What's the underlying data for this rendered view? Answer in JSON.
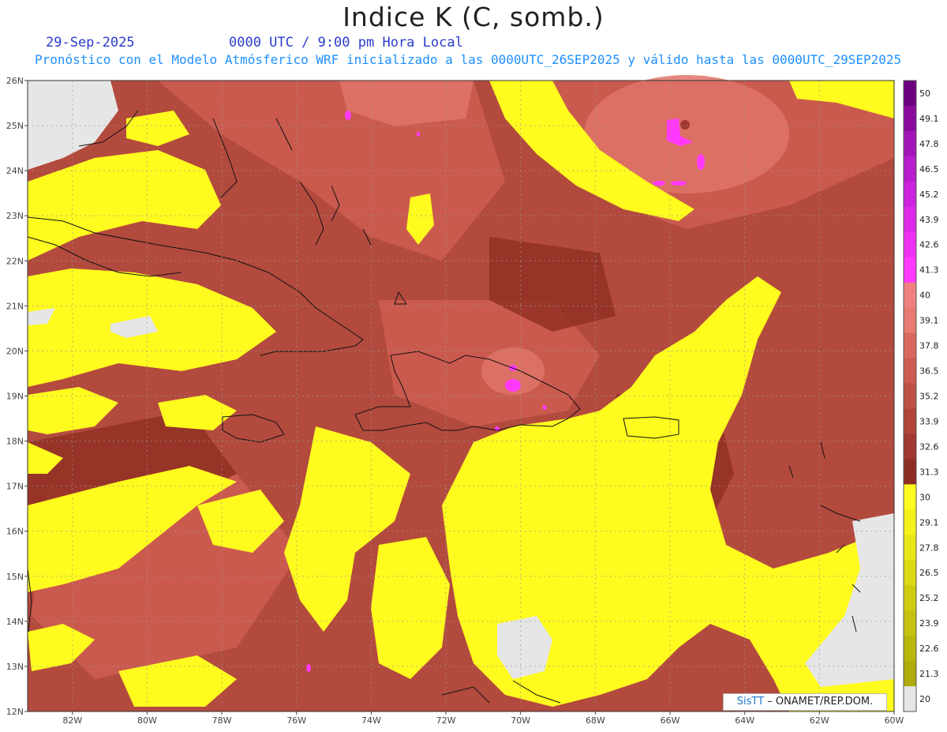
{
  "header": {
    "title": "Indice K (C, somb.)",
    "date": "29-Sep-2025",
    "time": "0000 UTC / 9:00 pm Hora Local",
    "subtitle": "Pronóstico con el Modelo Atmósferico WRF inicializado a las 0000UTC_26SEP2025 y válido hasta las  0000UTC_29SEP2025"
  },
  "map": {
    "lat_labels": [
      "26N",
      "25N",
      "24N",
      "23N",
      "22N",
      "21N",
      "20N",
      "19N",
      "18N",
      "17N",
      "16N",
      "15N",
      "14N",
      "13N",
      "12N"
    ],
    "lon_labels": [
      "82W",
      "80W",
      "78W",
      "76W",
      "74W",
      "72W",
      "70W",
      "68W",
      "66W",
      "64W",
      "62W",
      "60W"
    ],
    "lat_range": [
      12,
      26
    ],
    "lon_range": [
      -83.2,
      -60
    ],
    "grid": true
  },
  "colorbar": {
    "labels": [
      "50",
      "49.1",
      "47.8",
      "46.5",
      "45.2",
      "43.9",
      "42.6",
      "41.3",
      "40",
      "39.1",
      "37.8",
      "36.5",
      "35.2",
      "33.9",
      "32.6",
      "31.3",
      "30",
      "29.1",
      "27.8",
      "26.5",
      "25.2",
      "23.9",
      "22.6",
      "21.3",
      "20"
    ],
    "colors": [
      "#6a0080",
      "#8a0aa0",
      "#a314b8",
      "#b81ccc",
      "#cc22dd",
      "#dd2ae8",
      "#ee30f2",
      "#ff38ff",
      "#f08080",
      "#e87a72",
      "#d9685c",
      "#cd5c50",
      "#bf5046",
      "#b0443a",
      "#a13930",
      "#8e2e22",
      "#fffb1e",
      "#f4f11a",
      "#e8e616",
      "#dcd812",
      "#cfcc10",
      "#c4c20e",
      "#b9b60c",
      "#aeab0a",
      "#e6e6e6"
    ]
  },
  "credit": {
    "brand": "SisTT",
    "text": "– ONAMET/REP.DOM."
  }
}
